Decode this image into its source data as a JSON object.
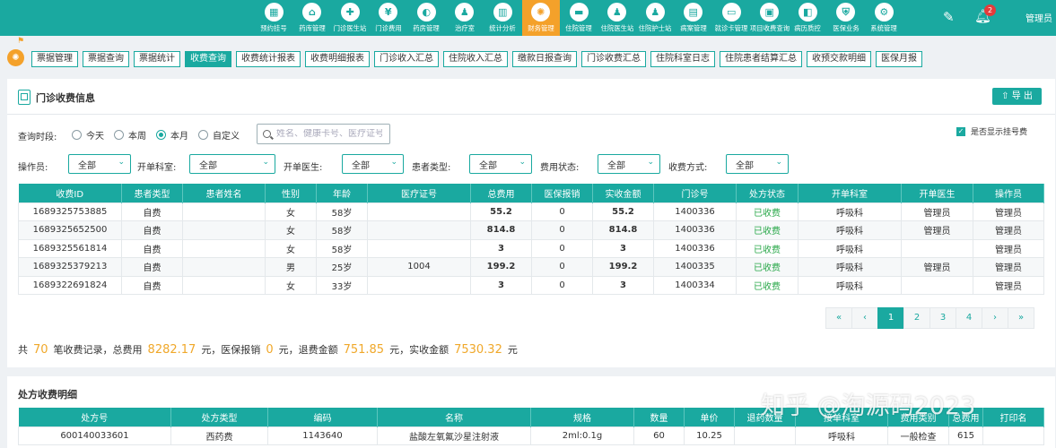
{
  "header": {
    "nav": [
      {
        "label": "预约挂号",
        "icon": "calendar-icon",
        "glyph": "▦"
      },
      {
        "label": "药库管理",
        "icon": "warehouse-icon",
        "glyph": "⌂"
      },
      {
        "label": "门诊医生站",
        "icon": "doctor-icon",
        "glyph": "✚"
      },
      {
        "label": "门诊费用",
        "icon": "yuan-icon",
        "glyph": "¥"
      },
      {
        "label": "药房管理",
        "icon": "pill-icon",
        "glyph": "◐"
      },
      {
        "label": "治疗室",
        "icon": "nurse-icon",
        "glyph": "♟"
      },
      {
        "label": "统计分析",
        "icon": "chart-icon",
        "glyph": "▥"
      },
      {
        "label": "财务管理",
        "icon": "finance-icon",
        "glyph": "✺",
        "active": true
      },
      {
        "label": "住院管理",
        "icon": "bed-icon",
        "glyph": "▬"
      },
      {
        "label": "住院医生站",
        "icon": "inpatient-doctor-icon",
        "glyph": "♟"
      },
      {
        "label": "住院护士站",
        "icon": "inpatient-nurse-icon",
        "glyph": "♟"
      },
      {
        "label": "病案管理",
        "icon": "record-icon",
        "glyph": "▤"
      },
      {
        "label": "就诊卡管理",
        "icon": "card-icon",
        "glyph": "▭"
      },
      {
        "label": "项目收费查询",
        "icon": "query-icon",
        "glyph": "▣"
      },
      {
        "label": "病历质控",
        "icon": "quality-icon",
        "glyph": "◧"
      },
      {
        "label": "医保业务",
        "icon": "insurance-icon",
        "glyph": "⛨"
      },
      {
        "label": "系统管理",
        "icon": "settings-icon",
        "glyph": "⚙"
      }
    ],
    "notification_count": "2",
    "user": "管理员"
  },
  "tabs": [
    {
      "label": "票据管理"
    },
    {
      "label": "票据查询"
    },
    {
      "label": "票据统计"
    },
    {
      "label": "收费查询",
      "active": true
    },
    {
      "label": "收费统计报表"
    },
    {
      "label": "收费明细报表"
    },
    {
      "label": "门诊收入汇总"
    },
    {
      "label": "住院收入汇总"
    },
    {
      "label": "缴款日报查询"
    },
    {
      "label": "门诊收费汇总"
    },
    {
      "label": "住院科室日志"
    },
    {
      "label": "住院患者结算汇总"
    },
    {
      "label": "收预交款明细"
    },
    {
      "label": "医保月报"
    }
  ],
  "panel1": {
    "title": "门诊收费信息",
    "export_label": "导 出",
    "period_label": "查询时段:",
    "period_options": [
      "今天",
      "本周",
      "本月",
      "自定义"
    ],
    "search_placeholder": "姓名、健康卡号、医疗证号、",
    "show_reg_fee_label": "是否显示挂号费",
    "filters": [
      {
        "label": "操作员:",
        "value": "全部"
      },
      {
        "label": "开单科室:",
        "value": "全部"
      },
      {
        "label": "开单医生:",
        "value": "全部"
      },
      {
        "label": "患者类型:",
        "value": "全部"
      },
      {
        "label": "费用状态:",
        "value": "全部"
      },
      {
        "label": "收费方式:",
        "value": "全部"
      }
    ],
    "columns": [
      "收费ID",
      "患者类型",
      "患者姓名",
      "性别",
      "年龄",
      "医疗证号",
      "总费用",
      "医保报销",
      "实收金额",
      "门诊号",
      "处方状态",
      "开单科室",
      "开单医生",
      "操作员"
    ],
    "rows": [
      [
        "1689325753885",
        "自费",
        "",
        "女",
        "58岁",
        "",
        "55.2",
        "0",
        "55.2",
        "1400336",
        "已收费",
        "呼吸科",
        "管理员",
        "管理员"
      ],
      [
        "1689325652500",
        "自费",
        "",
        "女",
        "58岁",
        "",
        "814.8",
        "0",
        "814.8",
        "1400336",
        "已收费",
        "呼吸科",
        "管理员",
        "管理员"
      ],
      [
        "1689325561814",
        "自费",
        "",
        "女",
        "58岁",
        "",
        "3",
        "0",
        "3",
        "1400336",
        "已收费",
        "呼吸科",
        "",
        "管理员"
      ],
      [
        "1689325379213",
        "自费",
        "",
        "男",
        "25岁",
        "1004",
        "199.2",
        "0",
        "199.2",
        "1400335",
        "已收费",
        "呼吸科",
        "管理员",
        "管理员"
      ],
      [
        "1689322691824",
        "自费",
        "",
        "女",
        "33岁",
        "",
        "3",
        "0",
        "3",
        "1400334",
        "已收费",
        "呼吸科",
        "",
        "管理员"
      ]
    ],
    "pager": [
      "«",
      "‹",
      "1",
      "2",
      "3",
      "4",
      "›",
      "»"
    ],
    "current_page": "1",
    "summary": {
      "t1": "共",
      "count": "70",
      "t2": "笔收费记录，总费用",
      "total": "8282.17",
      "t3": "元，医保报销",
      "insurance": "0",
      "t4": "元，退费金额",
      "refund": "751.85",
      "t5": "元，实收金额",
      "received": "7530.32",
      "t6": "元"
    }
  },
  "panel2": {
    "title": "处方收费明细",
    "columns": [
      "处方号",
      "处方类型",
      "编码",
      "名称",
      "规格",
      "数量",
      "单价",
      "退药数量",
      "接单科室",
      "费用类别",
      "总费用",
      "打印名"
    ],
    "rows": [
      [
        "600140033601",
        "西药费",
        "1143640",
        "盐酸左氧氟沙星注射液",
        "2ml:0.1g",
        "60",
        "10.25",
        "",
        "呼吸科",
        "一般检查",
        "615",
        ""
      ]
    ]
  },
  "watermark": "知乎 @淘源码2023",
  "colors": {
    "primary": "#1aa9a0",
    "accent": "#f4a12a",
    "status_green": "#2aa84a",
    "amount": "#f0a82a"
  }
}
